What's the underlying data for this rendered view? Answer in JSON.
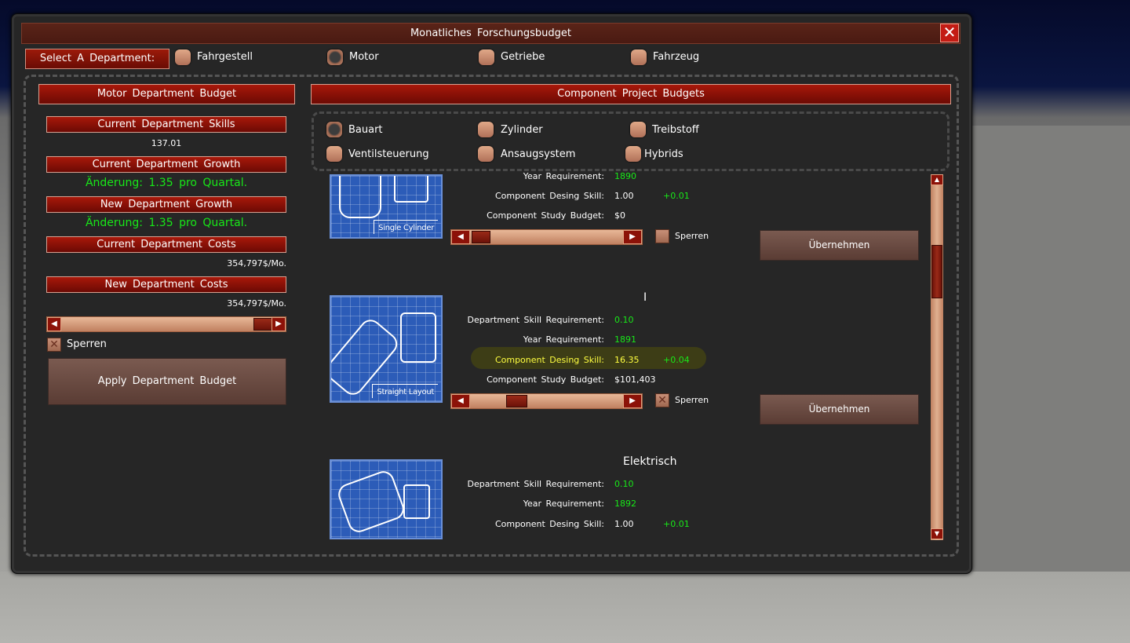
{
  "window": {
    "title": "Monatliches  Forschungsbudget",
    "close": "✕"
  },
  "department_select": {
    "label": "Select  A  Department:",
    "options": [
      {
        "label": "Fahrgestell",
        "selected": false
      },
      {
        "label": "Motor",
        "selected": true
      },
      {
        "label": "Getriebe",
        "selected": false
      },
      {
        "label": "Fahrzeug",
        "selected": false
      }
    ]
  },
  "left": {
    "header": "Motor  Department  Budget",
    "skills_label": "Current  Department  Skills",
    "skills_value": "137.01",
    "growth_label": "Current  Department  Growth",
    "growth_value": "Änderung:  1.35  pro  Quartal.",
    "new_growth_label": "New  Department  Growth",
    "new_growth_value": "Änderung:  1.35  pro  Quartal.",
    "costs_label": "Current  Department  Costs",
    "costs_value": "354,797$/Mo.",
    "new_costs_label": "New  Department  Costs",
    "new_costs_value": "354,797$/Mo.",
    "slider_fraction": 0.88,
    "lock_label": "Sperren",
    "apply_button": "Apply  Department  Budget"
  },
  "right": {
    "header": "Component  Project  Budgets",
    "tabs": [
      {
        "label": "Bauart",
        "selected": true
      },
      {
        "label": "Zylinder",
        "selected": false
      },
      {
        "label": "Treibstoff",
        "selected": false
      },
      {
        "label": "Ventilsteuerung",
        "selected": false
      },
      {
        "label": "Ansaugsystem",
        "selected": false
      },
      {
        "label": "Hybrids",
        "selected": false
      }
    ],
    "components": [
      {
        "image_label": "Single Cylinder",
        "title": "",
        "year_req_label": "Year  Requirement:",
        "year_req_value": "1890",
        "design_skill_label": "Component  Desing  Skill:",
        "design_skill_value": "1.00",
        "design_skill_delta": "+0.01",
        "study_budget_label": "Component  Study  Budget:",
        "study_budget_value": "$0",
        "lock_label": "Sperren",
        "apply_button": "Übernehmen"
      },
      {
        "image_label": "Straight Layout",
        "title": "I",
        "dept_req_label": "Department  Skill  Requirement:",
        "dept_req_value": "0.10",
        "year_req_label": "Year  Requirement:",
        "year_req_value": "1891",
        "design_skill_label": "Component  Desing  Skill:",
        "design_skill_value": "16.35",
        "design_skill_delta": "+0.04",
        "study_budget_label": "Component  Study  Budget:",
        "study_budget_value": "$101,403",
        "lock_label": "Sperren",
        "apply_button": "Übernehmen"
      },
      {
        "title": "Elektrisch",
        "dept_req_label": "Department  Skill  Requirement:",
        "dept_req_value": "0.10",
        "year_req_label": "Year  Requirement:",
        "year_req_value": "1892",
        "design_skill_label": "Component  Desing  Skill:",
        "design_skill_value": "1.00",
        "design_skill_delta": "+0.01"
      }
    ]
  },
  "colors": {
    "accent_red": "#8c1208",
    "value_green": "#18e818",
    "highlight_yellow": "#ffff40",
    "blueprint_blue": "#2c5cb8"
  }
}
